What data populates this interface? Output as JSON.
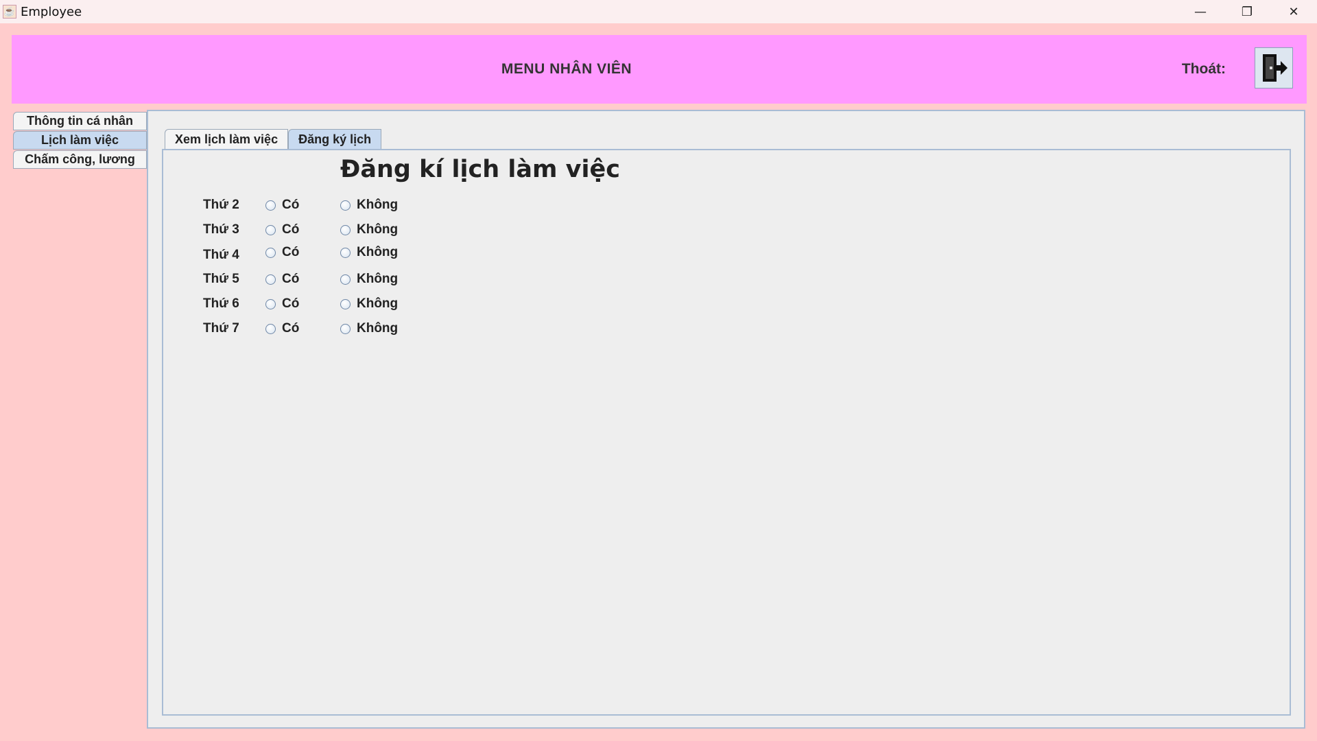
{
  "window": {
    "title": "Employee",
    "minimize_glyph": "—",
    "maximize_glyph": "❐",
    "close_glyph": "✕"
  },
  "header": {
    "title": "MENU NHÂN VIÊN",
    "exit_label": "Thoát:",
    "exit_icon": "exit-door-icon"
  },
  "side_tabs": [
    {
      "label": "Thông tin cá nhân",
      "active": false
    },
    {
      "label": "Lịch làm việc",
      "active": true
    },
    {
      "label": "Chấm công, lương",
      "active": false
    }
  ],
  "inner_tabs": [
    {
      "label": "Xem lịch làm việc",
      "active": false
    },
    {
      "label": "Đăng ký lịch",
      "active": true
    }
  ],
  "form": {
    "title": "Đăng kí lịch làm việc",
    "yes_label": "Có",
    "no_label": "Không",
    "days": [
      {
        "label": "Thứ 2"
      },
      {
        "label": "Thứ 3"
      },
      {
        "label": "Thứ 4"
      },
      {
        "label": "Thứ 5"
      },
      {
        "label": "Thứ 6"
      },
      {
        "label": "Thứ 7"
      }
    ]
  }
}
